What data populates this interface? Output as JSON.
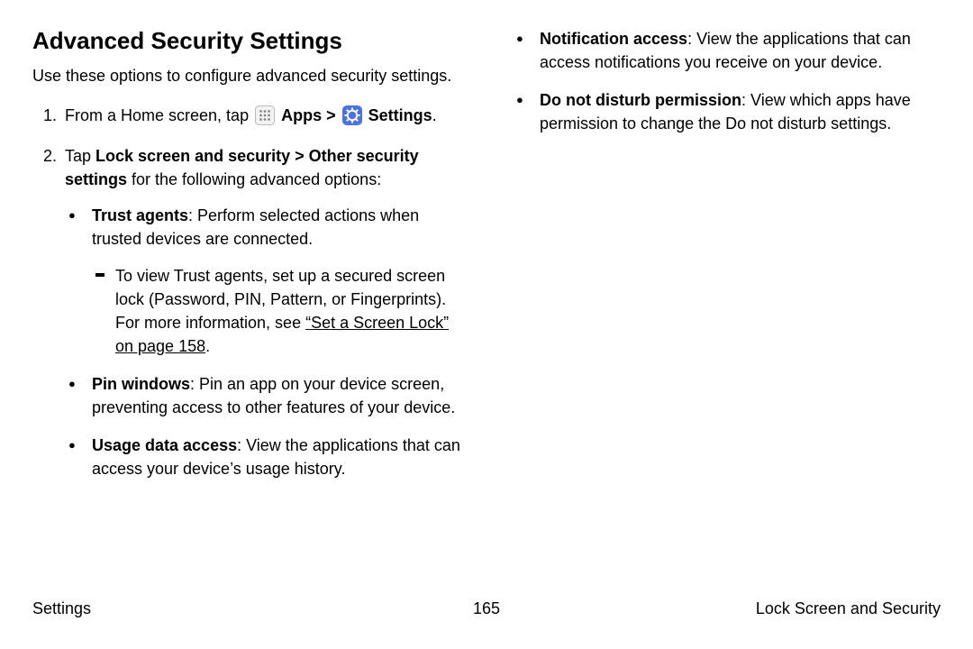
{
  "heading": "Advanced Security Settings",
  "intro": "Use these options to configure advanced security settings.",
  "step1_prefix": "From a Home screen, tap ",
  "apps_label": "Apps",
  "chevron": " > ",
  "settings_label": "Settings",
  "period": ".",
  "step2_prefix": "Tap ",
  "step2_bold": "Lock screen and security > Other security settings",
  "step2_suffix": " for the following advanced options:",
  "trust_bold": "Trust agents",
  "trust_text": ": Perform selected actions when trusted devices are connected.",
  "trust_sub_a": "To view Trust agents, set up a secured screen lock (Password, PIN, Pattern, or Fingerprints). For more information, see ",
  "trust_sub_link": "“Set a Screen Lock” on page 158",
  "pin_bold": "Pin windows",
  "pin_text": ": Pin an app on your device screen, preventing access to other features of your device.",
  "usage_bold": "Usage data access",
  "usage_text": ": View the applications that can access your device’s usage history.",
  "notif_bold": "Notification access",
  "notif_text": ": View the applications that can access notifications you receive on your device.",
  "dnd_bold": "Do not disturb permission",
  "dnd_text": ": View which apps have permission to change the Do not disturb settings.",
  "footer_left": "Settings",
  "footer_center": "165",
  "footer_right": "Lock Screen and Security"
}
